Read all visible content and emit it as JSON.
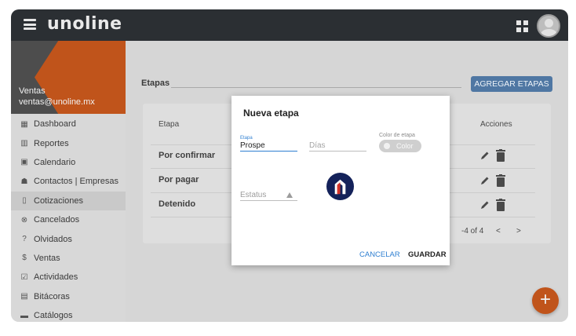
{
  "header": {
    "logo": "unoline",
    "menu_icon": "hamburger-menu-icon",
    "apps_icon": "apps-grid-icon",
    "avatar_icon": "user-avatar-icon"
  },
  "sidebar": {
    "user_name": "Ventas",
    "user_email": "ventas@unoline.mx",
    "items": [
      {
        "label": "Dashboard",
        "icon": "dashboard-icon",
        "glyph": "▦"
      },
      {
        "label": "Reportes",
        "icon": "bar-chart-icon",
        "glyph": "▥"
      },
      {
        "label": "Calendario",
        "icon": "calendar-icon",
        "glyph": "▣"
      },
      {
        "label": "Contactos | Empresas",
        "icon": "contacts-icon",
        "glyph": "☗"
      },
      {
        "label": "Cotizaciones",
        "icon": "document-icon",
        "glyph": "▯"
      },
      {
        "label": "Cancelados",
        "icon": "cancel-circle-icon",
        "glyph": "⊗"
      },
      {
        "label": "Olvidados",
        "icon": "question-icon",
        "glyph": "?"
      },
      {
        "label": "Ventas",
        "icon": "dollar-icon",
        "glyph": "$"
      },
      {
        "label": "Actividades",
        "icon": "checkbox-icon",
        "glyph": "☑"
      },
      {
        "label": "Bitácoras",
        "icon": "clipboard-icon",
        "glyph": "▤"
      },
      {
        "label": "Catálogos",
        "icon": "folder-icon",
        "glyph": "▬"
      }
    ],
    "active_index": 4
  },
  "main": {
    "section_title": "Etapas",
    "add_button": "AGREGAR ETAPAS",
    "table": {
      "col_etapa": "Etapa",
      "col_acciones": "Acciones",
      "rows": [
        "Por confirmar",
        "Por pagar",
        "Detenido"
      ]
    },
    "pager": {
      "info": "-4 of 4",
      "prev": "<",
      "next": ">"
    }
  },
  "fab_label": "+",
  "modal": {
    "title": "Nueva etapa",
    "etapa_label": "Etapa",
    "etapa_value": "Prospe",
    "dias_placeholder": "Días",
    "color_label": "Color de etapa",
    "color_button": "Color",
    "estatus_placeholder": "Estatus",
    "cancel": "CANCELAR",
    "save": "GUARDAR"
  },
  "colors": {
    "accent_orange": "#c0541b",
    "topbar": "#2b2f33",
    "button_blue": "#4f77a3",
    "link_blue": "#2f7fd1",
    "brand_navy": "#14225a",
    "brand_red": "#d6342b"
  }
}
